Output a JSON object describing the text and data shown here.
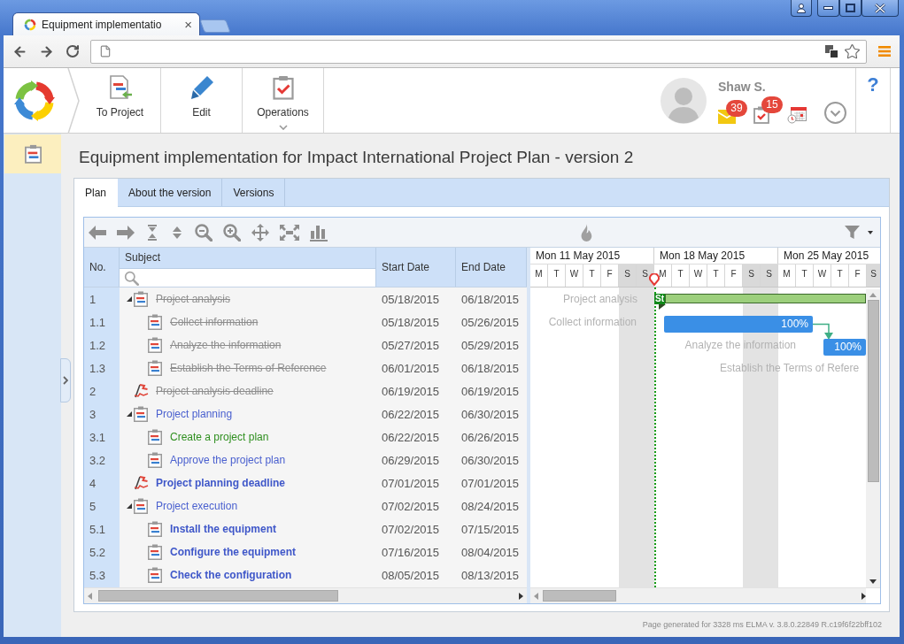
{
  "browser": {
    "tab": {
      "title": "Equipment implementatio",
      "close": "×"
    }
  },
  "app_toolbar": {
    "buttons": [
      {
        "kind": "to_project",
        "label": "To Project",
        "dropdown": false
      },
      {
        "kind": "edit",
        "label": "Edit",
        "dropdown": false
      },
      {
        "kind": "operations",
        "label": "Operations",
        "dropdown": true
      }
    ],
    "user": {
      "name": "Shaw S.",
      "indicators": [
        {
          "kind": "mail",
          "count": "39"
        },
        {
          "kind": "tasks",
          "count": "15"
        },
        {
          "kind": "calendar"
        }
      ]
    },
    "help": "?"
  },
  "sidebar": {
    "items": [
      {
        "kind": "plan",
        "selected": true
      }
    ]
  },
  "page": {
    "title": "Equipment implementation for Impact International Project Plan - version 2",
    "tabs": [
      {
        "label": "Plan",
        "selected": true
      },
      {
        "label": "About the version",
        "selected": false
      },
      {
        "label": "Versions",
        "selected": false
      }
    ]
  },
  "gantt": {
    "columns": [
      "No.",
      "Subject",
      "Start Date",
      "End Date"
    ],
    "rows": [
      {
        "no": "1",
        "subject": "Project analysis",
        "start": "05/18/2015",
        "end": "06/18/2015",
        "kind": "summary",
        "completed": true,
        "in_progress": false,
        "bold": false,
        "expanded": true,
        "children": [
          {
            "no": "1.1",
            "subject": "Collect information",
            "start": "05/18/2015",
            "end": "05/26/2015",
            "kind": "task",
            "completed": true,
            "in_progress": false,
            "bold": false
          },
          {
            "no": "1.2",
            "subject": "Analyze the information",
            "start": "05/27/2015",
            "end": "05/29/2015",
            "kind": "task",
            "completed": true,
            "in_progress": false,
            "bold": false
          },
          {
            "no": "1.3",
            "subject": "Establish the Terms of Reference",
            "start": "06/01/2015",
            "end": "06/18/2015",
            "kind": "task",
            "completed": true,
            "in_progress": false,
            "bold": false
          }
        ]
      },
      {
        "no": "2",
        "subject": "Project analysis deadline",
        "start": "06/19/2015",
        "end": "06/19/2015",
        "kind": "milestone",
        "completed": true,
        "in_progress": false,
        "bold": false
      },
      {
        "no": "3",
        "subject": "Project planning",
        "start": "06/22/2015",
        "end": "06/30/2015",
        "kind": "summary",
        "completed": false,
        "in_progress": false,
        "bold": false,
        "expanded": true,
        "children": [
          {
            "no": "3.1",
            "subject": "Create a project plan",
            "start": "06/22/2015",
            "end": "06/26/2015",
            "kind": "task",
            "completed": false,
            "in_progress": true,
            "bold": false
          },
          {
            "no": "3.2",
            "subject": "Approve the project plan",
            "start": "06/29/2015",
            "end": "06/30/2015",
            "kind": "task",
            "completed": false,
            "in_progress": false,
            "bold": false
          }
        ]
      },
      {
        "no": "4",
        "subject": "Project planning deadline",
        "start": "07/01/2015",
        "end": "07/01/2015",
        "kind": "milestone",
        "completed": false,
        "in_progress": false,
        "bold": true
      },
      {
        "no": "5",
        "subject": "Project execution",
        "start": "07/02/2015",
        "end": "08/24/2015",
        "kind": "summary",
        "completed": false,
        "in_progress": false,
        "bold": false,
        "expanded": true,
        "children": [
          {
            "no": "5.1",
            "subject": "Install the equipment",
            "start": "07/02/2015",
            "end": "07/15/2015",
            "kind": "task",
            "completed": false,
            "in_progress": false,
            "bold": true
          },
          {
            "no": "5.2",
            "subject": "Configure the equipment",
            "start": "07/16/2015",
            "end": "08/04/2015",
            "kind": "task",
            "completed": false,
            "in_progress": false,
            "bold": true
          },
          {
            "no": "5.3",
            "subject": "Check the configuration",
            "start": "08/05/2015",
            "end": "08/13/2015",
            "kind": "task",
            "completed": false,
            "in_progress": false,
            "bold": true
          }
        ]
      }
    ],
    "timeline": {
      "weeks": [
        {
          "label": "Mon 11 May 2015",
          "days": [
            {
              "label": "M",
              "weekend": false
            },
            {
              "label": "T",
              "weekend": false
            },
            {
              "label": "W",
              "weekend": false
            },
            {
              "label": "T",
              "weekend": false
            },
            {
              "label": "F",
              "weekend": false
            },
            {
              "label": "S",
              "weekend": true
            },
            {
              "label": "S",
              "weekend": true
            }
          ]
        },
        {
          "label": "Mon 18 May 2015",
          "days": [
            {
              "label": "M",
              "weekend": false
            },
            {
              "label": "T",
              "weekend": false
            },
            {
              "label": "W",
              "weekend": false
            },
            {
              "label": "T",
              "weekend": false
            },
            {
              "label": "F",
              "weekend": false
            },
            {
              "label": "S",
              "weekend": true
            },
            {
              "label": "S",
              "weekend": true
            }
          ]
        },
        {
          "label": "Mon 25 May 2015",
          "days": [
            {
              "label": "M",
              "weekend": false
            },
            {
              "label": "T",
              "weekend": false
            },
            {
              "label": "W",
              "weekend": false
            },
            {
              "label": "T",
              "weekend": false
            },
            {
              "label": "F",
              "weekend": false
            },
            {
              "label": "S",
              "weekend": true
            }
          ]
        }
      ]
    },
    "bars": [
      {
        "kind": "summary",
        "label": "Project analysis",
        "tag": "St"
      },
      {
        "kind": "task",
        "label": "Collect information",
        "progress": "100%",
        "link": true
      },
      {
        "kind": "task",
        "label": "Analyze the information",
        "progress": "100%",
        "link": false
      },
      {
        "kind": "label",
        "label": "Establish the Terms of Refere"
      }
    ]
  },
  "footer": "Page generated for 3328 ms ELMA v. 3.8.0.22849 R.c19f6f22bff102"
}
